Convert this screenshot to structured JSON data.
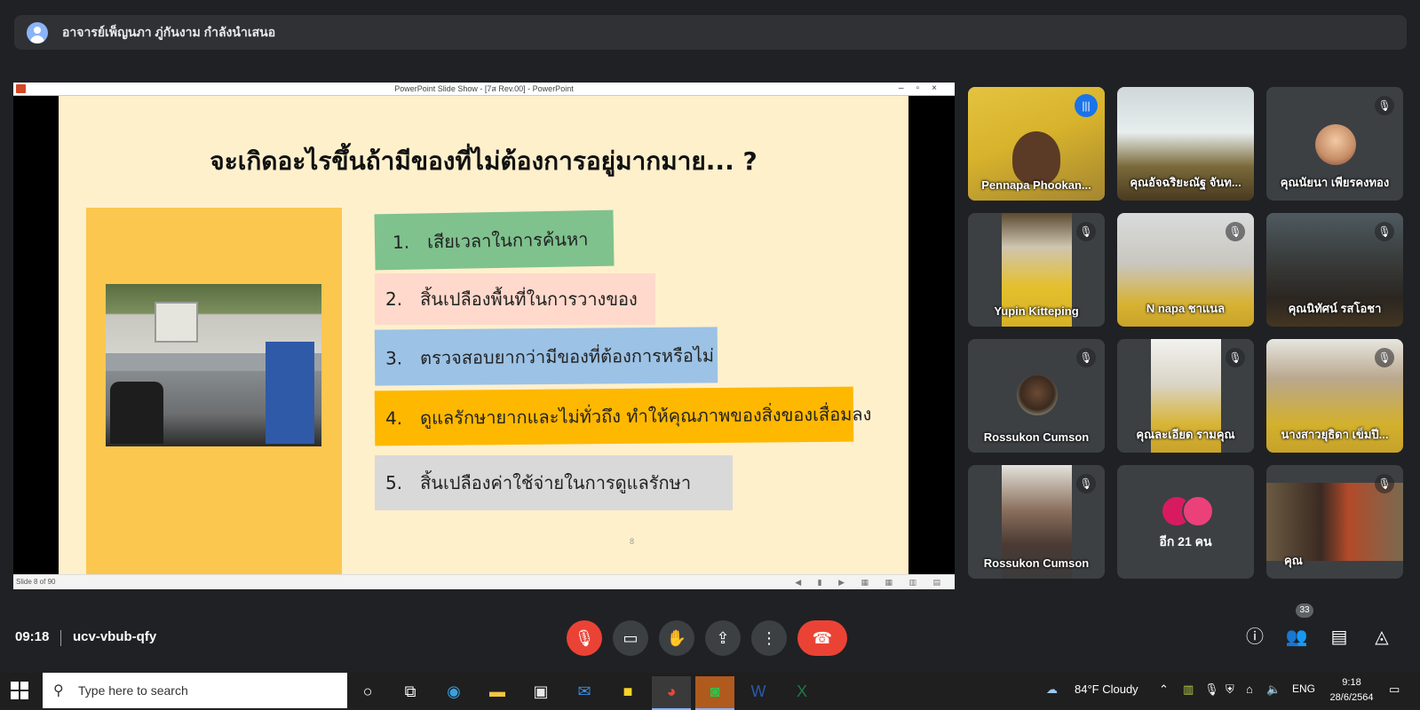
{
  "presenter_bar": {
    "text": "อาจารย์เพ็ญนภา ภู่กันงาม กำลังนำเสนอ"
  },
  "powerpoint": {
    "window_title": "PowerPoint Slide Show - [7ส Rev.00] - PowerPoint",
    "window_buttons": "–▫×",
    "status_left": "Slide 8 of 90",
    "status_right": "◀ ▮ ▶ ▦ ▦ ▥ ▤",
    "slide": {
      "title": "จะเกิดอะไรขึ้นถ้ามีของที่ไม่ต้องการอยู่มากมาย... ?",
      "page_number": "8",
      "items": [
        {
          "num": "1.",
          "text": "เสียเวลาในการค้นหา",
          "color": "#7fc28e"
        },
        {
          "num": "2.",
          "text": "สิ้นเปลืองพื้นที่ในการวางของ",
          "color": "#ffd9cc"
        },
        {
          "num": "3.",
          "text": "ตรวจสอบยากว่ามีของที่ต้องการหรือไม่",
          "color": "#9cc2e5"
        },
        {
          "num": "4.",
          "text": "ดูแลรักษายากและไม่ทั่วถึง ทำให้คุณภาพของสิ่งของเสื่อมลง",
          "color": "#ffb800"
        },
        {
          "num": "5.",
          "text": "สิ้นเปลืองค่าใช้จ่ายในการดูแลรักษา",
          "color": "#d9d9d9"
        }
      ]
    }
  },
  "participants": [
    {
      "name": "Pennapa Phookan...",
      "muted": false,
      "speaking": true
    },
    {
      "name": "คุณอัจฉริยะณัฐ จันท...",
      "muted": false,
      "speaking": false
    },
    {
      "name": "คุณนัยนา เพียรคงทอง",
      "muted": true,
      "speaking": false
    },
    {
      "name": "Yupin Kitteping",
      "muted": true,
      "speaking": false
    },
    {
      "name": "N napa ชาแนล",
      "muted": true,
      "speaking": false
    },
    {
      "name": "คุณนิทัศน์ รสโอชา",
      "muted": true,
      "speaking": false
    },
    {
      "name": "Rossukon Cumson",
      "muted": true,
      "speaking": false
    },
    {
      "name": "คุณละเอียด รามคุณ",
      "muted": true,
      "speaking": false
    },
    {
      "name": "นางสาวยุธิดา เข็มปี...",
      "muted": true,
      "speaking": false
    },
    {
      "name": "Rossukon Cumson",
      "muted": true,
      "speaking": false
    },
    {
      "name": "อีก 21 คน",
      "muted": false,
      "speaking": false
    },
    {
      "name": "คุณ",
      "muted": true,
      "speaking": false
    }
  ],
  "controls": {
    "time": "09:18",
    "meeting_code": "ucv-vbub-qfy",
    "participant_count": "33",
    "icons": [
      "mic-off-icon",
      "camera-icon",
      "raise-hand-icon",
      "present-icon",
      "more-options-icon",
      "end-call-icon",
      "info-icon",
      "people-icon",
      "chat-icon",
      "activities-icon"
    ]
  },
  "taskbar": {
    "search_placeholder": "Type here to search",
    "weather": "84°F  Cloudy",
    "lang": "ENG",
    "time": "9:18",
    "date": "28/6/2564"
  },
  "colors": {
    "meet_bg": "#202124",
    "tile_bg": "#3c4043",
    "red": "#ea4335",
    "accent": "#8ab4f8",
    "slide_bg": "#fff0cc",
    "panel_yellow": "#fbc74f"
  }
}
